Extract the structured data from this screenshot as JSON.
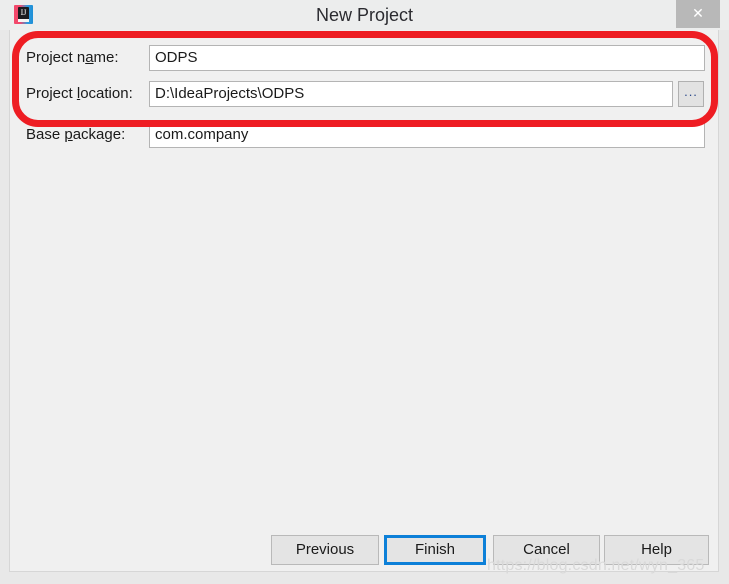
{
  "window": {
    "title": "New Project",
    "app_icon": "intellij-idea-icon",
    "close_label": "✕"
  },
  "form": {
    "fields": [
      {
        "label_before": "Project n",
        "label_mnemonic": "a",
        "label_after": "me:",
        "value": "ODPS",
        "name": "project-name"
      },
      {
        "label_before": "Project ",
        "label_mnemonic": "l",
        "label_after": "ocation:",
        "value": "D:\\IdeaProjects\\ODPS",
        "name": "project-location"
      },
      {
        "label_before": "Base ",
        "label_mnemonic": "p",
        "label_after": "ackage:",
        "value": "com.company",
        "name": "base-package"
      }
    ],
    "browse_label": "..."
  },
  "annotation": {
    "color": "#ee1d23",
    "shape": "rounded-rectangle"
  },
  "buttons": [
    {
      "label": "Previous",
      "name": "previous-button",
      "default": false
    },
    {
      "label": "Finish",
      "name": "finish-button",
      "default": true
    },
    {
      "label": "Cancel",
      "name": "cancel-button",
      "default": false
    },
    {
      "label": "Help",
      "name": "help-button",
      "default": false
    }
  ],
  "watermark": {
    "text": "https://blog.csdn.net/wyn_365"
  },
  "colors": {
    "accent": "#0d80d8",
    "annotation": "#ee1d23",
    "dialog_bg": "#f0f0f0",
    "titlebar_bg": "#eceded"
  }
}
